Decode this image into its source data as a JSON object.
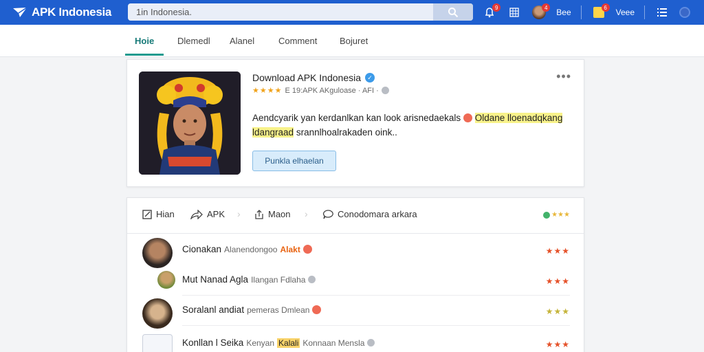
{
  "header": {
    "brand": "APK Indonesia",
    "search_value": "1in Indonesia.",
    "user1_label": "Bee",
    "user2_label": "Veee",
    "badge_notifications": "9",
    "badge_user": "4",
    "badge_note": "6",
    "colors": {
      "bar": "#1f5fcf",
      "accent": "#1f9a8f"
    }
  },
  "nav": {
    "items": [
      "Hoie",
      "Dlemedl",
      "Alanel",
      "Comment",
      "Bojuret"
    ],
    "active_index": 0
  },
  "hero": {
    "title": "Download APK Indonesia",
    "rating_text": "★★★★",
    "meta": "E 19:APK AKguloase · AFI ·",
    "desc_line1": "Aendcyarik yan kerdanlkan kan look arisnedaekals",
    "desc_highlight1": "Oldane lloenadqkang",
    "desc_highlight2": "ldangraad",
    "desc_line2": "srannlhoalrakaden oink..",
    "cta_label": "Punkla elhaelan"
  },
  "list": {
    "tabs": [
      {
        "label": "Hian",
        "icon": "edit-icon"
      },
      {
        "label": "APK",
        "icon": "share-icon"
      },
      {
        "label": "Maon",
        "icon": "upload-icon"
      },
      {
        "label": "Conodomara arkara",
        "icon": "comment-icon"
      }
    ],
    "tab_stars": "★★★",
    "rows": [
      {
        "name": "Cionakan",
        "sub": "Alanendongoo",
        "tag": "Alakt",
        "tag_style": "orange",
        "stars": "★★★"
      },
      {
        "name": "Mut Nanad Agla",
        "sub": "Ilangan Fdlaha",
        "tag": "",
        "tag_style": "grey",
        "stars": "★★★"
      },
      {
        "name": "Soralanl andiat",
        "sub": "pemeras Dmlean",
        "tag": "",
        "tag_style": "red",
        "stars": "★★★"
      },
      {
        "name": "Konllan l Seika",
        "sub": "Kenyan",
        "tag": "Kalali",
        "tag_style": "hl",
        "extra": "Konnaan Mensla",
        "stars": "★★★"
      }
    ]
  }
}
